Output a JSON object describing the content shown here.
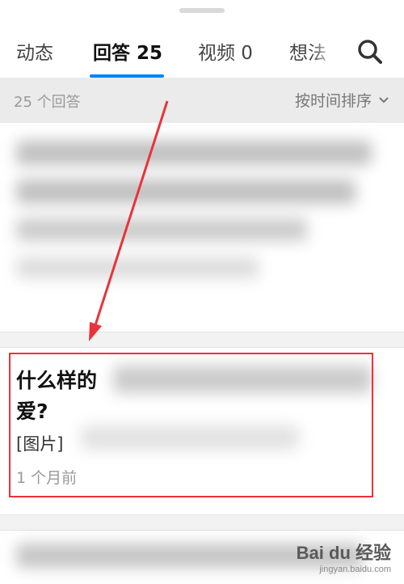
{
  "tabs": [
    {
      "label": "动态"
    },
    {
      "label": "回答 25"
    },
    {
      "label": "视频 0"
    },
    {
      "label": "想法 "
    }
  ],
  "accent_color": "#0084ff",
  "highlight_color": "#e8333b",
  "subheader": {
    "count_text": "25 个回答",
    "sort_label": "按时间排序"
  },
  "answer": {
    "title": "什么样的\n爱?",
    "excerpt": "[图片]",
    "time": "1 个月前"
  },
  "watermark": {
    "logo": "Bai du 经验",
    "url": "jingyan.baidu.com"
  }
}
